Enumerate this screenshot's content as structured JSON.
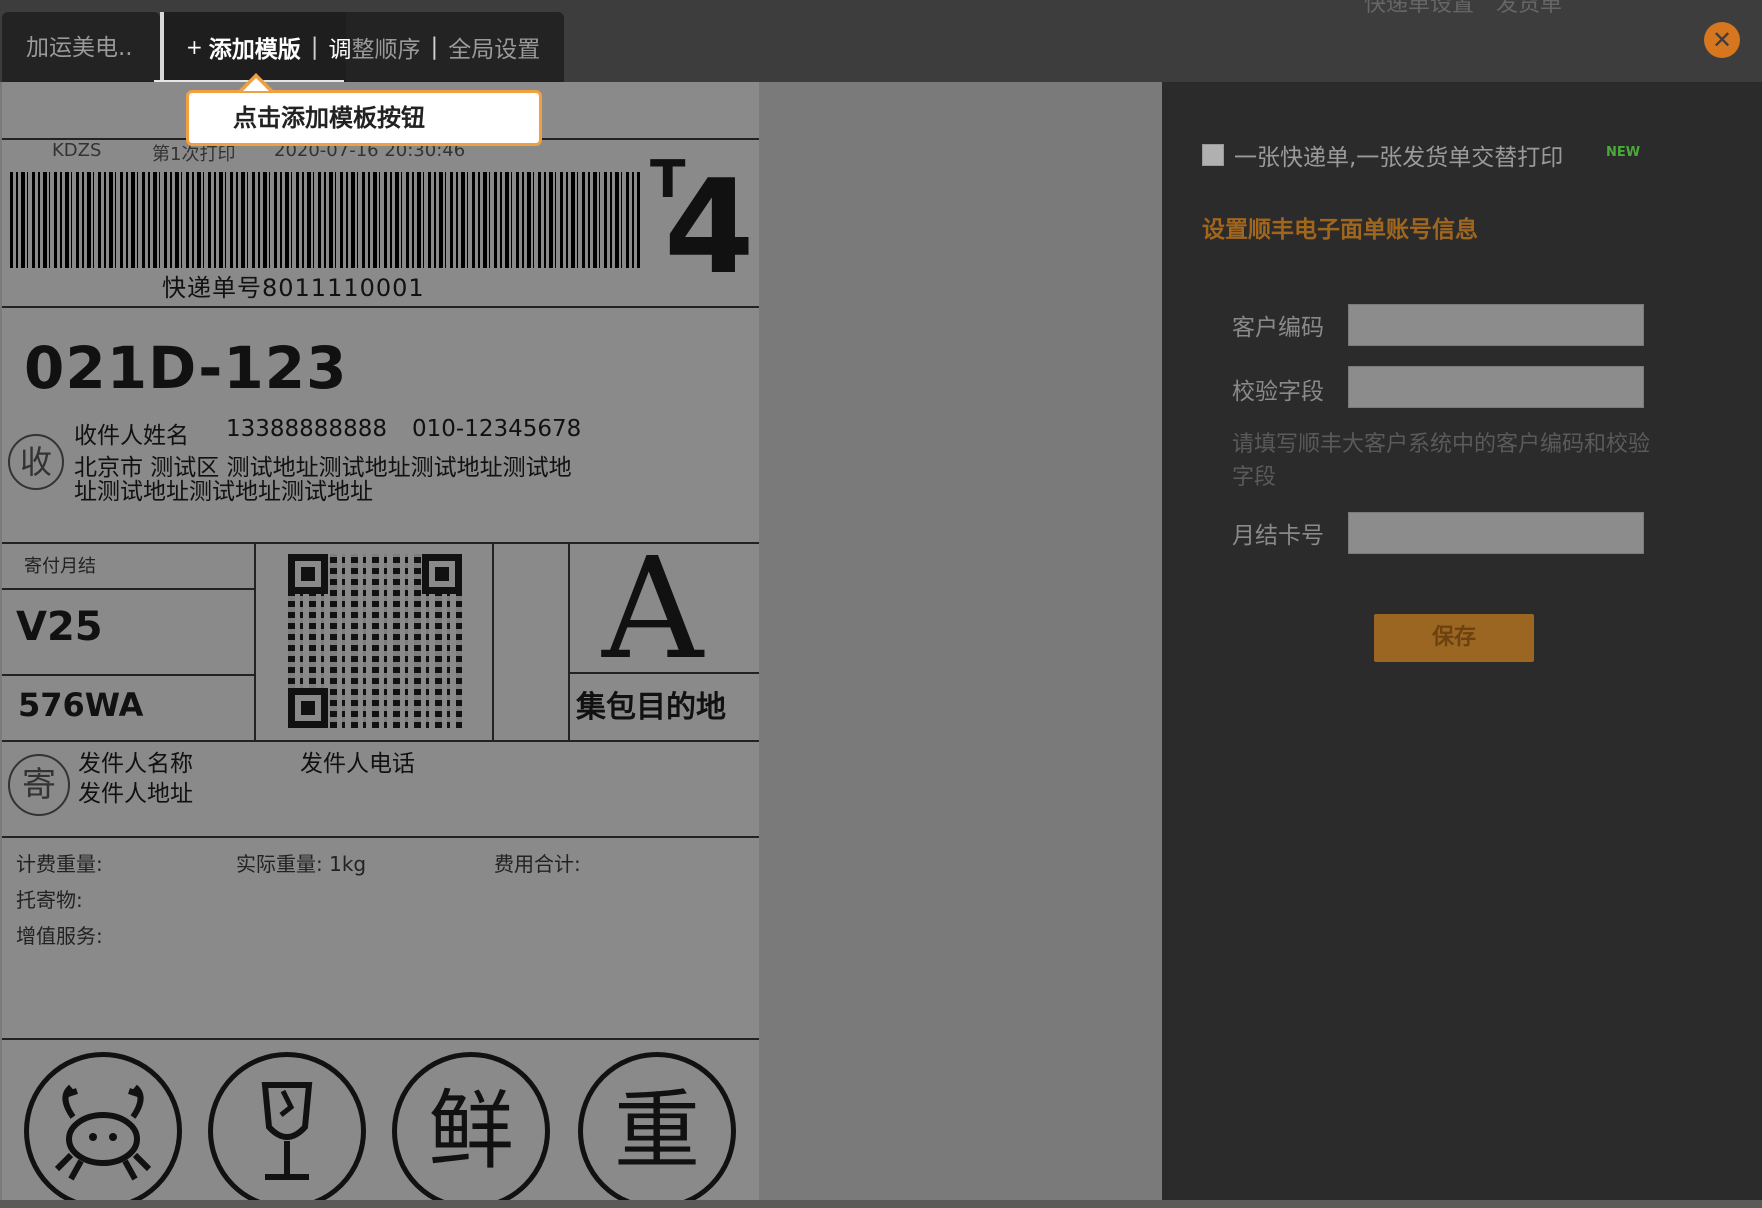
{
  "topbar": {
    "right_text_1": "快递单设置",
    "right_text_2": "发货单",
    "close_glyph": "✕"
  },
  "tabs": {
    "store": "加运美电..",
    "plus_glyph": "+",
    "add_template": "添加模版",
    "sep": "|",
    "adjust_hl": "调",
    "adjust_rest": "整顺序",
    "global_settings": "全局设置"
  },
  "tooltip": {
    "text": "点击添加模板按钮"
  },
  "label": {
    "brand": "KDZS",
    "print_count": "第1次打印",
    "print_time": "2020-07-16 20:30:46",
    "t_mark": "T",
    "big_number": "4",
    "tracking_number": "快递单号8011110001",
    "route_code": "021D-123",
    "recv_char": "收",
    "receiver_name": "收件人姓名",
    "receiver_mobile": "13388888888",
    "receiver_phone": "010-12345678",
    "receiver_addr_line1": "北京市 测试区 测试地址测试地址测试地址测试地",
    "receiver_addr_line2": "址测试地址测试地址测试地址",
    "pay_type": "寄付月结",
    "code_1": "V25",
    "code_2": "576WA",
    "big_letter": "A",
    "hub_label": "集包目的地",
    "send_char": "寄",
    "sender_name": "发件人名称",
    "sender_phone": "发件人电话",
    "sender_addr": "发件人地址",
    "charged_weight": "计费重量:",
    "actual_weight": "实际重量: 1kg",
    "total_fee": "费用合计:",
    "goods": "托寄物:",
    "value_added": "增值服务:",
    "icon_fresh": "鲜",
    "icon_heavy": "重"
  },
  "settings": {
    "checkbox_label": "一张快递单,一张发货单交替打印",
    "new_badge": "NEW",
    "section_title": "设置顺丰电子面单账号信息",
    "customer_code_label": "客户编码",
    "customer_code_value": "",
    "verify_field_label": "校验字段",
    "verify_field_value": "",
    "hint": "请填写顺丰大客户系统中的客户编码和校验字段",
    "monthly_card_label": "月结卡号",
    "monthly_card_value": "",
    "save_label": "保存"
  },
  "colors": {
    "accent_orange": "#d6761f",
    "section_title": "#a0661e",
    "save_button": "#9b6622",
    "panel_bg": "#2b2b2b",
    "new_badge": "#4aaa3a"
  },
  "icons": [
    "plus-icon",
    "close-icon",
    "crab-icon",
    "fragile-glass-icon"
  ]
}
